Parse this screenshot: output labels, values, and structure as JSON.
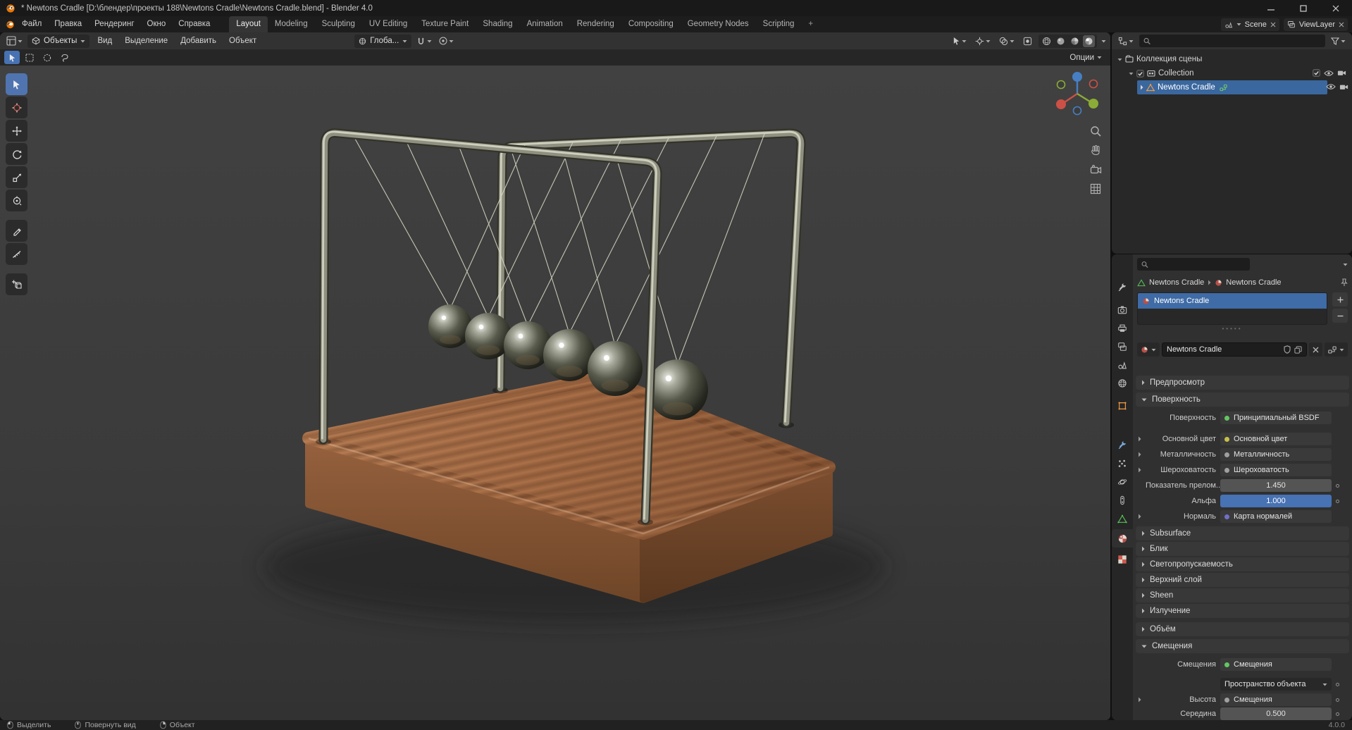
{
  "colors": {
    "accent": "#4772b3",
    "selection": "#3a679e",
    "viewport_bg": "#3a3a3a",
    "wood": "#a9714b",
    "metal": "#9a9a88"
  },
  "window": {
    "title": "* Newtons Cradle [D:\\блендер\\проекты 188\\Newtons Cradle\\Newtons Cradle.blend] - Blender 4.0"
  },
  "topbar": {
    "menus": [
      {
        "label": "Файл"
      },
      {
        "label": "Правка"
      },
      {
        "label": "Рендеринг"
      },
      {
        "label": "Окно"
      },
      {
        "label": "Справка"
      }
    ],
    "workspaces": [
      {
        "label": "Layout"
      },
      {
        "label": "Modeling"
      },
      {
        "label": "Sculpting"
      },
      {
        "label": "UV Editing"
      },
      {
        "label": "Texture Paint"
      },
      {
        "label": "Shading"
      },
      {
        "label": "Animation"
      },
      {
        "label": "Rendering"
      },
      {
        "label": "Compositing"
      },
      {
        "label": "Geometry Nodes"
      },
      {
        "label": "Scripting"
      }
    ],
    "add_workspace": "+",
    "scene": {
      "label": "Scene"
    },
    "view_layer": {
      "label": "ViewLayer"
    }
  },
  "viewport": {
    "mode": "Объекты",
    "menus": [
      {
        "label": "Вид"
      },
      {
        "label": "Выделение"
      },
      {
        "label": "Добавить"
      },
      {
        "label": "Объект"
      }
    ],
    "orientation": "Глоба...",
    "options": "Опции"
  },
  "outliner": {
    "rows": [
      {
        "label": "Коллекция сцены"
      },
      {
        "label": "Collection"
      },
      {
        "label": "Newtons Cradle"
      }
    ]
  },
  "properties": {
    "breadcrumb": {
      "object": "Newtons Cradle",
      "material": "Newtons Cradle"
    },
    "slots": [
      {
        "name": "Newtons Cradle"
      }
    ],
    "material_name": "Newtons Cradle",
    "panels": {
      "preview": "Предпросмотр",
      "surface": "Поверхность",
      "subsurface": "Subsurface",
      "specular": "Блик",
      "transmission": "Светопропускаемость",
      "coat": "Верхний слой",
      "sheen": "Sheen",
      "emission": "Излучение",
      "volume": "Объём",
      "displacement": "Смещения"
    },
    "surface_rows": [
      {
        "label": "Поверхность",
        "value": "Принципиальный BSDF"
      },
      {
        "label": "Основной цвет",
        "value": "Основной цвет"
      },
      {
        "label": "Металличность",
        "value": "Металличность"
      },
      {
        "label": "Шероховатость",
        "value": "Шероховатость"
      },
      {
        "label": "Показатель прелом...",
        "value": "1.450"
      },
      {
        "label": "Альфа",
        "value": "1.000"
      },
      {
        "label": "Нормаль",
        "value": "Карта нормалей"
      }
    ],
    "displacement_rows": [
      {
        "label": "Смещения",
        "value": "Смещения"
      },
      {
        "label": "",
        "value": "Пространство объекта"
      },
      {
        "label": "Высота",
        "value": "Смещения"
      },
      {
        "label": "Середина",
        "value": "0.500"
      }
    ]
  },
  "statusbar": {
    "items": [
      {
        "label": "Выделить"
      },
      {
        "label": "Повернуть вид"
      },
      {
        "label": "Объект"
      }
    ],
    "version": "4.0.0"
  }
}
